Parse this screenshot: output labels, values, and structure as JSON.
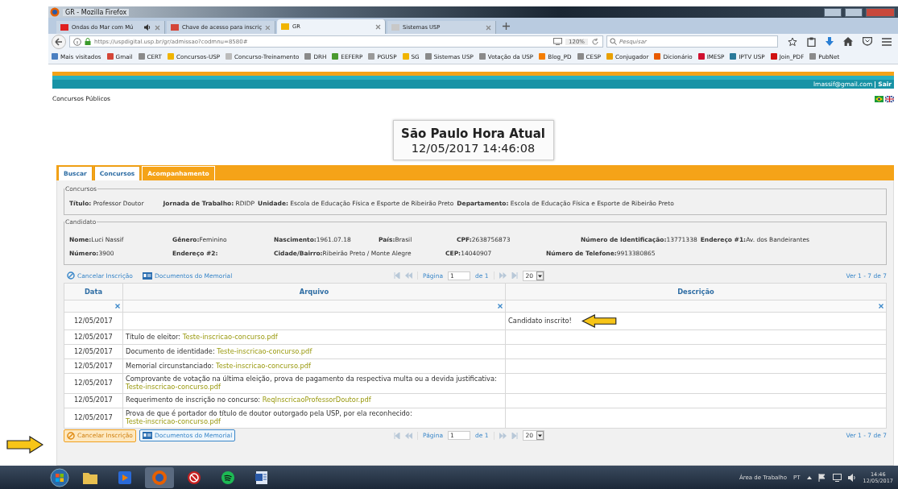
{
  "window": {
    "title": "GR - Mozilla Firefox"
  },
  "tabs": [
    {
      "label": "Ondas do Mar com Mú",
      "selected": false,
      "audio": true,
      "color": "#e02020"
    },
    {
      "label": "Chave de acesso para inscriç",
      "selected": false,
      "audio": false,
      "color": "#d44638"
    },
    {
      "label": "GR",
      "selected": true,
      "audio": false,
      "color": "#f0b400"
    },
    {
      "label": "Sistemas USP",
      "selected": false,
      "audio": false,
      "color": "#c8c8c8"
    }
  ],
  "address": {
    "url": "https://uspdigital.usp.br/gr/admissao?codmnu=8580#",
    "zoom": "120%"
  },
  "search": {
    "placeholder": "Pesquisar"
  },
  "bookmarks": [
    {
      "label": "Mais visitados",
      "color": "#4a7fc1"
    },
    {
      "label": "Gmail",
      "color": "#d44638"
    },
    {
      "label": "CERT",
      "color": "#8a8a8a"
    },
    {
      "label": "Concursos-USP",
      "color": "#f0b400"
    },
    {
      "label": "Concurso-Treinamento",
      "color": "#bbbbbb"
    },
    {
      "label": "DRH",
      "color": "#8a8a8a"
    },
    {
      "label": "EEFERP",
      "color": "#4a9a30"
    },
    {
      "label": "PGUSP",
      "color": "#999999"
    },
    {
      "label": "SG",
      "color": "#f0b400"
    },
    {
      "label": "Sistemas USP",
      "color": "#8a8a8a"
    },
    {
      "label": "Votação da USP",
      "color": "#8a8a8a"
    },
    {
      "label": "Blog_PD",
      "color": "#f57d00"
    },
    {
      "label": "CESP",
      "color": "#8a8a8a"
    },
    {
      "label": "Conjugador",
      "color": "#e8a000"
    },
    {
      "label": "Dicionário",
      "color": "#e85a00"
    },
    {
      "label": "IMESP",
      "color": "#d01030"
    },
    {
      "label": "IPTV USP",
      "color": "#2a7a9a"
    },
    {
      "label": "Join_PDF",
      "color": "#d01010"
    },
    {
      "label": "PubNet",
      "color": "#8a8a8a"
    }
  ],
  "user": {
    "email": "lmassif@gmail.com",
    "logout": "Sair"
  },
  "breadcrumb": "Concursos Públicos",
  "clock": {
    "title": "São Paulo Hora Atual",
    "datetime": "12/05/2017 14:46:08"
  },
  "page_tabs": [
    {
      "label": "Buscar",
      "selected": false
    },
    {
      "label": "Concursos",
      "selected": false
    },
    {
      "label": "Acompanhamento",
      "selected": true
    }
  ],
  "concursos": {
    "legend": "Concursos",
    "fields": [
      {
        "label": "Título:",
        "value": "Professor Doutor"
      },
      {
        "label": "Jornada de Trabalho:",
        "value": "RDIDP"
      },
      {
        "label": "Unidade:",
        "value": "Escola de Educação Física e Esporte de Ribeirão Preto"
      },
      {
        "label": "Departamento:",
        "value": "Escola de Educação Física e Esporte de Ribeirão Preto"
      }
    ]
  },
  "candidato": {
    "legend": "Candidato",
    "lines": [
      {
        "fields": [
          {
            "label": "Nome:",
            "value": "Luci Nassif"
          },
          {
            "label": "Gênero:",
            "value": "Feminino"
          },
          {
            "label": "Nascimento:",
            "value": "1961.07.18"
          },
          {
            "label": "País:",
            "value": "Brasil"
          },
          {
            "label": "CPF:",
            "value": "2638756873"
          },
          {
            "label": "Número de Identificação:",
            "value": "13771338"
          },
          {
            "label": "Endereço #1:",
            "value": "Av. dos Bandeirantes"
          }
        ]
      },
      {
        "fields": [
          {
            "label": "Número:",
            "value": "3900"
          },
          {
            "label": "Endereço #2:"
          },
          {
            "label": "Cidade/Bairro:",
            "value": "Ribeirão Preto / Monte Alegre"
          },
          {
            "label": "CEP:",
            "value": "14040907"
          },
          {
            "label": "Número de Telefone:",
            "value": "9913380865"
          }
        ]
      }
    ]
  },
  "toolbars": [
    {
      "cancel": {
        "label": "Cancelar Inscrição",
        "highlighted": false
      },
      "docs": "Documentos do Memorial",
      "pager": {
        "page_label": "Página",
        "page": "1",
        "of": "de 1",
        "page_size": "20"
      },
      "range": "Ver 1 - 7 de 7"
    },
    {
      "cancel": {
        "label": "Cancelar Inscrição",
        "highlighted": true
      },
      "docs": "Documentos do Memorial",
      "pager": {
        "page_label": "Página",
        "page": "1",
        "of": "de 1",
        "page_size": "20"
      },
      "range": "Ver 1 - 7 de 7"
    }
  ],
  "table": {
    "columns": [
      "Data",
      "Arquivo",
      "Descrição"
    ],
    "rows": [
      {
        "date": "12/05/2017",
        "description": "Candidato inscrito!"
      },
      {
        "date": "12/05/2017",
        "label": "Título de eleitor:",
        "file": "Teste-inscricao-concurso.pdf"
      },
      {
        "date": "12/05/2017",
        "label": "Documento de identidade:",
        "file": "Teste-inscricao-concurso.pdf"
      },
      {
        "date": "12/05/2017",
        "label": "Memorial circunstanciado:",
        "file": "Teste-inscricao-concurso.pdf"
      },
      {
        "date": "12/05/2017",
        "label": "Comprovante de votação na última eleição, prova de pagamento da respectiva multa ou a devida justificativa:",
        "file": "Teste-inscricao-concurso.pdf"
      },
      {
        "date": "12/05/2017",
        "label": "Requerimento de inscrição no concurso:",
        "file": "ReqInscricaoProfessorDoutor.pdf"
      },
      {
        "date": "12/05/2017",
        "label": "Prova de que é portador do título de doutor outorgado pela USP, por ela reconhecido:",
        "file": "Teste-inscricao-concurso.pdf"
      }
    ]
  },
  "taskbar": {
    "desktop": "Área de Trabalho",
    "language": "PT",
    "time": "14:46",
    "date": "12/05/2017"
  }
}
